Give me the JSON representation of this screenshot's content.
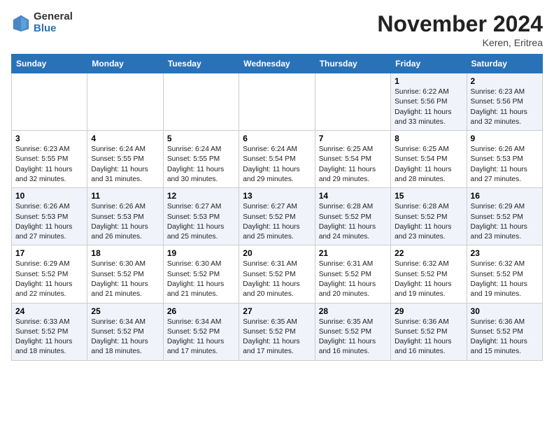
{
  "header": {
    "logo": {
      "general": "General",
      "blue": "Blue"
    },
    "title": "November 2024",
    "location": "Keren, Eritrea"
  },
  "weekdays": [
    "Sunday",
    "Monday",
    "Tuesday",
    "Wednesday",
    "Thursday",
    "Friday",
    "Saturday"
  ],
  "weeks": [
    [
      {
        "day": "",
        "detail": ""
      },
      {
        "day": "",
        "detail": ""
      },
      {
        "day": "",
        "detail": ""
      },
      {
        "day": "",
        "detail": ""
      },
      {
        "day": "",
        "detail": ""
      },
      {
        "day": "1",
        "detail": "Sunrise: 6:22 AM\nSunset: 5:56 PM\nDaylight: 11 hours and 33 minutes."
      },
      {
        "day": "2",
        "detail": "Sunrise: 6:23 AM\nSunset: 5:56 PM\nDaylight: 11 hours and 32 minutes."
      }
    ],
    [
      {
        "day": "3",
        "detail": "Sunrise: 6:23 AM\nSunset: 5:55 PM\nDaylight: 11 hours and 32 minutes."
      },
      {
        "day": "4",
        "detail": "Sunrise: 6:24 AM\nSunset: 5:55 PM\nDaylight: 11 hours and 31 minutes."
      },
      {
        "day": "5",
        "detail": "Sunrise: 6:24 AM\nSunset: 5:55 PM\nDaylight: 11 hours and 30 minutes."
      },
      {
        "day": "6",
        "detail": "Sunrise: 6:24 AM\nSunset: 5:54 PM\nDaylight: 11 hours and 29 minutes."
      },
      {
        "day": "7",
        "detail": "Sunrise: 6:25 AM\nSunset: 5:54 PM\nDaylight: 11 hours and 29 minutes."
      },
      {
        "day": "8",
        "detail": "Sunrise: 6:25 AM\nSunset: 5:54 PM\nDaylight: 11 hours and 28 minutes."
      },
      {
        "day": "9",
        "detail": "Sunrise: 6:26 AM\nSunset: 5:53 PM\nDaylight: 11 hours and 27 minutes."
      }
    ],
    [
      {
        "day": "10",
        "detail": "Sunrise: 6:26 AM\nSunset: 5:53 PM\nDaylight: 11 hours and 27 minutes."
      },
      {
        "day": "11",
        "detail": "Sunrise: 6:26 AM\nSunset: 5:53 PM\nDaylight: 11 hours and 26 minutes."
      },
      {
        "day": "12",
        "detail": "Sunrise: 6:27 AM\nSunset: 5:53 PM\nDaylight: 11 hours and 25 minutes."
      },
      {
        "day": "13",
        "detail": "Sunrise: 6:27 AM\nSunset: 5:52 PM\nDaylight: 11 hours and 25 minutes."
      },
      {
        "day": "14",
        "detail": "Sunrise: 6:28 AM\nSunset: 5:52 PM\nDaylight: 11 hours and 24 minutes."
      },
      {
        "day": "15",
        "detail": "Sunrise: 6:28 AM\nSunset: 5:52 PM\nDaylight: 11 hours and 23 minutes."
      },
      {
        "day": "16",
        "detail": "Sunrise: 6:29 AM\nSunset: 5:52 PM\nDaylight: 11 hours and 23 minutes."
      }
    ],
    [
      {
        "day": "17",
        "detail": "Sunrise: 6:29 AM\nSunset: 5:52 PM\nDaylight: 11 hours and 22 minutes."
      },
      {
        "day": "18",
        "detail": "Sunrise: 6:30 AM\nSunset: 5:52 PM\nDaylight: 11 hours and 21 minutes."
      },
      {
        "day": "19",
        "detail": "Sunrise: 6:30 AM\nSunset: 5:52 PM\nDaylight: 11 hours and 21 minutes."
      },
      {
        "day": "20",
        "detail": "Sunrise: 6:31 AM\nSunset: 5:52 PM\nDaylight: 11 hours and 20 minutes."
      },
      {
        "day": "21",
        "detail": "Sunrise: 6:31 AM\nSunset: 5:52 PM\nDaylight: 11 hours and 20 minutes."
      },
      {
        "day": "22",
        "detail": "Sunrise: 6:32 AM\nSunset: 5:52 PM\nDaylight: 11 hours and 19 minutes."
      },
      {
        "day": "23",
        "detail": "Sunrise: 6:32 AM\nSunset: 5:52 PM\nDaylight: 11 hours and 19 minutes."
      }
    ],
    [
      {
        "day": "24",
        "detail": "Sunrise: 6:33 AM\nSunset: 5:52 PM\nDaylight: 11 hours and 18 minutes."
      },
      {
        "day": "25",
        "detail": "Sunrise: 6:34 AM\nSunset: 5:52 PM\nDaylight: 11 hours and 18 minutes."
      },
      {
        "day": "26",
        "detail": "Sunrise: 6:34 AM\nSunset: 5:52 PM\nDaylight: 11 hours and 17 minutes."
      },
      {
        "day": "27",
        "detail": "Sunrise: 6:35 AM\nSunset: 5:52 PM\nDaylight: 11 hours and 17 minutes."
      },
      {
        "day": "28",
        "detail": "Sunrise: 6:35 AM\nSunset: 5:52 PM\nDaylight: 11 hours and 16 minutes."
      },
      {
        "day": "29",
        "detail": "Sunrise: 6:36 AM\nSunset: 5:52 PM\nDaylight: 11 hours and 16 minutes."
      },
      {
        "day": "30",
        "detail": "Sunrise: 6:36 AM\nSunset: 5:52 PM\nDaylight: 11 hours and 15 minutes."
      }
    ]
  ]
}
